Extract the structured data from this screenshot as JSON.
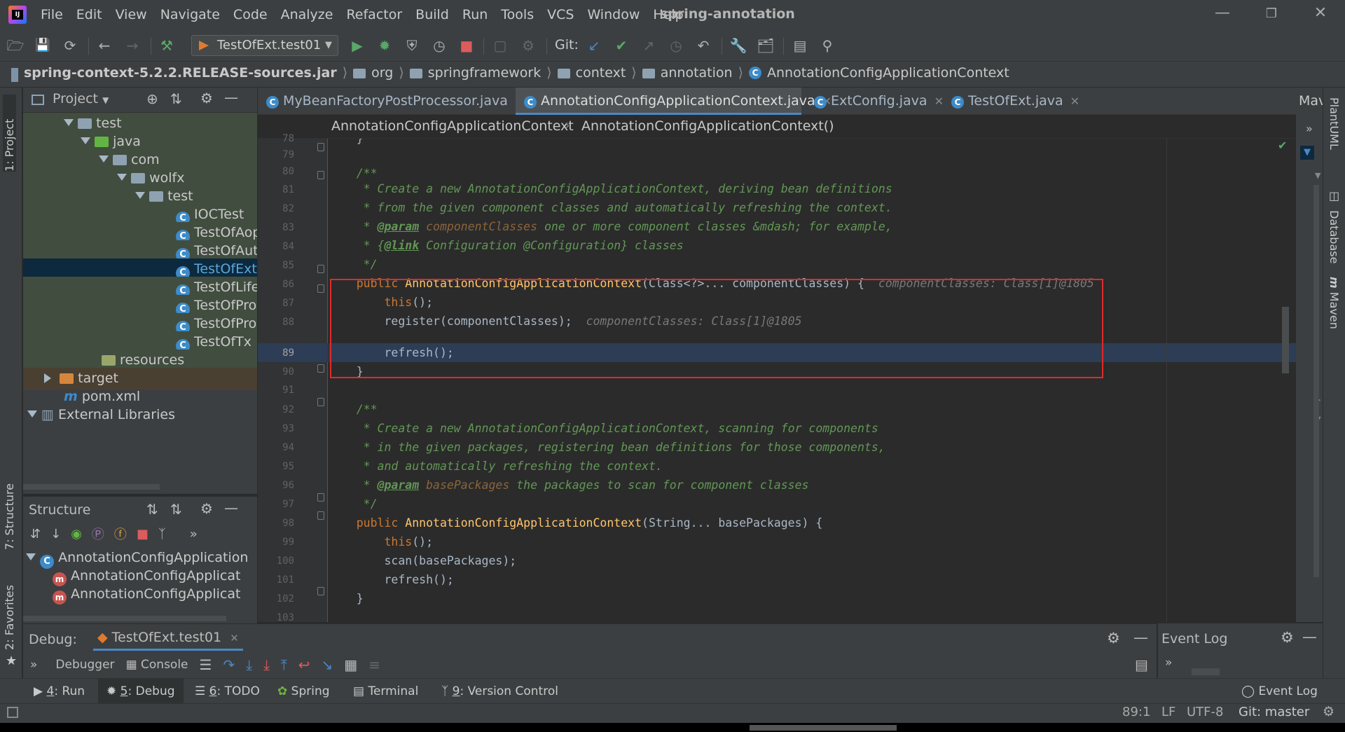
{
  "menu": {
    "items": [
      "File",
      "Edit",
      "View",
      "Navigate",
      "Code",
      "Analyze",
      "Refactor",
      "Build",
      "Run",
      "Tools",
      "VCS",
      "Window",
      "Help"
    ],
    "project_name": "spring-annotation"
  },
  "toolbar": {
    "run_config": "TestOfExt.test01",
    "git_label": "Git:"
  },
  "navbar": {
    "jar": "spring-context-5.2.2.RELEASE-sources.jar",
    "crumbs": [
      "org",
      "springframework",
      "context",
      "annotation"
    ],
    "class": "AnnotationConfigApplicationContext"
  },
  "left_strip": {
    "project_tab": "1: Project",
    "structure_tab": "7: Structure",
    "favorites_tab": "2: Favorites"
  },
  "right_strip": {
    "plantuml": "PlantUML",
    "database": "Database",
    "maven": "Maven",
    "maven_short": "Mav"
  },
  "project": {
    "title": "Project",
    "tree": [
      {
        "label": "test"
      },
      {
        "label": "java"
      },
      {
        "label": "com"
      },
      {
        "label": "wolfx"
      },
      {
        "label": "test"
      },
      {
        "label": "IOCTest"
      },
      {
        "label": "TestOfAop"
      },
      {
        "label": "TestOfAut"
      },
      {
        "label": "TestOfExt"
      },
      {
        "label": "TestOfLife"
      },
      {
        "label": "TestOfPro"
      },
      {
        "label": "TestOfPro"
      },
      {
        "label": "TestOfTx"
      },
      {
        "label": "resources"
      },
      {
        "label": "target"
      },
      {
        "label": "pom.xml"
      },
      {
        "label": "External Libraries"
      }
    ]
  },
  "structure": {
    "title": "Structure",
    "items": [
      "AnnotationConfigApplication",
      "AnnotationConfigApplicat",
      "AnnotationConfigApplicat"
    ]
  },
  "editor": {
    "tabs": [
      "MyBeanFactoryPostProcessor.java",
      "AnnotationConfigApplicationContext.java",
      "ExtConfig.java",
      "TestOfExt.java"
    ],
    "active_tab": 1,
    "crumb_class": "AnnotationConfigApplicationContext",
    "crumb_method": "AnnotationConfigApplicationContext()",
    "line_numbers": [
      "78",
      "79",
      "80",
      "81",
      "82",
      "83",
      "84",
      "85",
      "86",
      "87",
      "88",
      "89",
      "90",
      "91",
      "92",
      "93",
      "94",
      "95",
      "96",
      "97",
      "98",
      "99",
      "100",
      "101",
      "102",
      "103"
    ],
    "current_line": "89",
    "code": {
      "l78": "    }",
      "l80": "    /**",
      "l81": "     * Create a new AnnotationConfigApplicationContext, deriving bean definitions",
      "l82": "     * from the given component classes and automatically refreshing the context.",
      "l83_star": "     * ",
      "l83_tag": "@param",
      "l83_param": "componentClasses",
      "l83_rest": " one or more component classes &mdash; for example,",
      "l84_star": "     * {",
      "l84_tag": "@link",
      "l84_rest": " Configuration @Configuration} classes",
      "l85": "     */",
      "l86_kw": "    public ",
      "l86_fn": "AnnotationConfigApplicationContext",
      "l86_rest": "(Class<?>... componentClasses) {",
      "l86_hint": "componentClasses: Class[1]@1805",
      "l87_kw": "        this",
      "l87_rest": "();",
      "l88": "        register(componentClasses);",
      "l88_hint": "componentClasses: Class[1]@1805",
      "l89": "        refresh();",
      "l90": "    }",
      "l92": "    /**",
      "l93": "     * Create a new AnnotationConfigApplicationContext, scanning for components",
      "l94": "     * in the given packages, registering bean definitions for those components,",
      "l95": "     * and automatically refreshing the context.",
      "l96_star": "     * ",
      "l96_tag": "@param",
      "l96_param": "basePackages",
      "l96_rest": " the packages to scan for component classes",
      "l97": "     */",
      "l98_kw": "    public ",
      "l98_fn": "AnnotationConfigApplicationContext",
      "l98_rest": "(String... basePackages) {",
      "l99_kw": "        this",
      "l99_rest": "();",
      "l100": "        scan(basePackages);",
      "l101": "        refresh();",
      "l102": "    }"
    }
  },
  "debug": {
    "label": "Debug:",
    "session": "TestOfExt.test01",
    "tab_debugger": "Debugger",
    "tab_console": "Console"
  },
  "event_log": {
    "title": "Event Log"
  },
  "bottom_tabs": {
    "run_num": "4",
    "run": ": Run",
    "debug_num": "5",
    "debug": ": Debug",
    "todo_num": "6",
    "todo": ": TODO",
    "spring": "Spring",
    "terminal": "Terminal",
    "vc_num": "9",
    "vc": ": Version Control",
    "event_log": "Event Log"
  },
  "status": {
    "position": "89:1",
    "line_sep": "LF",
    "encoding": "UTF-8",
    "git": "Git: master"
  },
  "colors": {
    "accent": "#4a88c7",
    "highlight_box": "#e02a2a",
    "run_green": "#59a869",
    "stop_red": "#db5c5c"
  }
}
